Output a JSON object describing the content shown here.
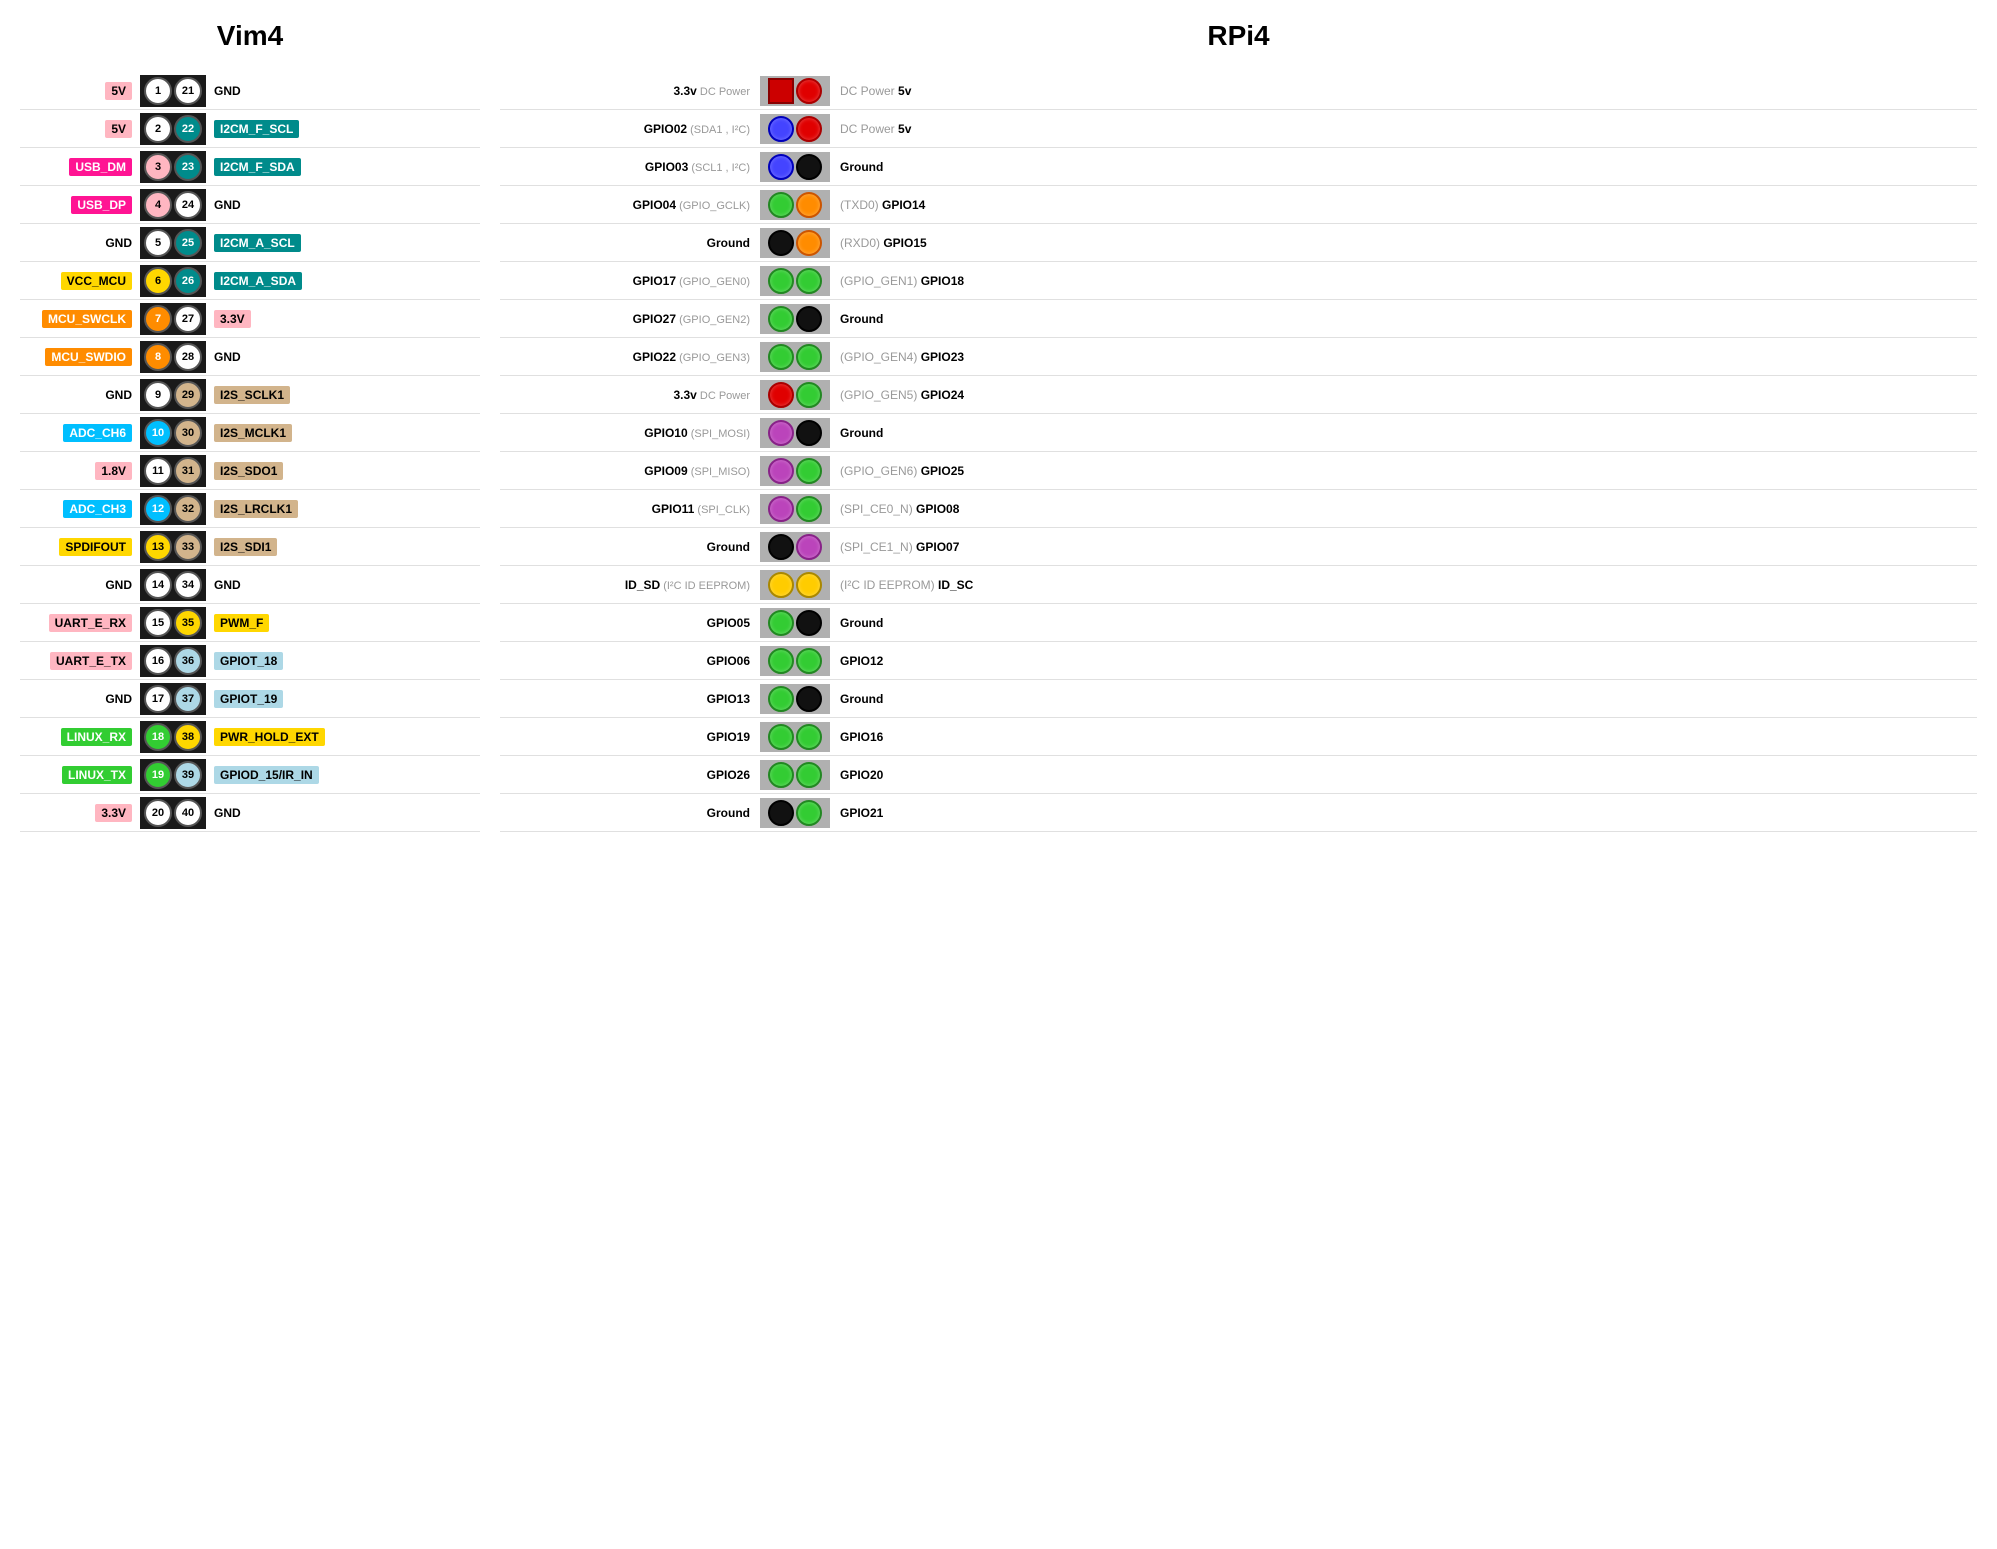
{
  "headers": {
    "vim4": "Vim4",
    "rpi4": "RPi4"
  },
  "vim4_rows": [
    {
      "left": "5V",
      "left_bg": "pink",
      "pin1": "1",
      "pin1_style": "white",
      "pin2": "21",
      "pin2_style": "white",
      "right": "GND",
      "right_bg": ""
    },
    {
      "left": "5V",
      "left_bg": "pink",
      "pin1": "2",
      "pin1_style": "white",
      "pin2": "22",
      "pin2_style": "teal",
      "right": "I2CM_F_SCL",
      "right_bg": "teal"
    },
    {
      "left": "USB_DM",
      "left_bg": "magenta",
      "pin1": "3",
      "pin1_style": "pink",
      "pin2": "23",
      "pin2_style": "teal",
      "right": "I2CM_F_SDA",
      "right_bg": "teal"
    },
    {
      "left": "USB_DP",
      "left_bg": "magenta",
      "pin1": "4",
      "pin1_style": "pink",
      "pin2": "24",
      "pin2_style": "white",
      "right": "GND",
      "right_bg": ""
    },
    {
      "left": "GND",
      "left_bg": "",
      "pin1": "5",
      "pin1_style": "white",
      "pin2": "25",
      "pin2_style": "teal",
      "right": "I2CM_A_SCL",
      "right_bg": "teal"
    },
    {
      "left": "VCC_MCU",
      "left_bg": "yellow",
      "pin1": "6",
      "pin1_style": "yellow",
      "pin2": "26",
      "pin2_style": "teal",
      "right": "I2CM_A_SDA",
      "right_bg": "teal"
    },
    {
      "left": "MCU_SWCLK",
      "left_bg": "orange",
      "pin1": "7",
      "pin1_style": "orange",
      "pin2": "27",
      "pin2_style": "white",
      "right": "3.3V",
      "right_bg": "pink"
    },
    {
      "left": "MCU_SWDIO",
      "left_bg": "orange",
      "pin1": "8",
      "pin1_style": "orange",
      "pin2": "28",
      "pin2_style": "white",
      "right": "GND",
      "right_bg": ""
    },
    {
      "left": "GND",
      "left_bg": "",
      "pin1": "9",
      "pin1_style": "white",
      "pin2": "29",
      "pin2_style": "tan",
      "right": "I2S_SCLK1",
      "right_bg": "tan"
    },
    {
      "left": "ADC_CH6",
      "left_bg": "blue",
      "pin1": "10",
      "pin1_style": "blue",
      "pin2": "30",
      "pin2_style": "tan",
      "right": "I2S_MCLK1",
      "right_bg": "tan"
    },
    {
      "left": "1.8V",
      "left_bg": "pink",
      "pin1": "11",
      "pin1_style": "white",
      "pin2": "31",
      "pin2_style": "tan",
      "right": "I2S_SDO1",
      "right_bg": "tan"
    },
    {
      "left": "ADC_CH3",
      "left_bg": "blue",
      "pin1": "12",
      "pin1_style": "blue",
      "pin2": "32",
      "pin2_style": "tan",
      "right": "I2S_LRCLK1",
      "right_bg": "tan"
    },
    {
      "left": "SPDIFOUT",
      "left_bg": "yellow",
      "pin1": "13",
      "pin1_style": "yellow",
      "pin2": "33",
      "pin2_style": "tan",
      "right": "I2S_SDI1",
      "right_bg": "tan"
    },
    {
      "left": "GND",
      "left_bg": "",
      "pin1": "14",
      "pin1_style": "white",
      "pin2": "34",
      "pin2_style": "white",
      "right": "GND",
      "right_bg": ""
    },
    {
      "left": "UART_E_RX",
      "left_bg": "pink",
      "pin1": "15",
      "pin1_style": "white",
      "pin2": "35",
      "pin2_style": "yellow",
      "right": "PWM_F",
      "right_bg": "yellow"
    },
    {
      "left": "UART_E_TX",
      "left_bg": "pink",
      "pin1": "16",
      "pin1_style": "white",
      "pin2": "36",
      "pin2_style": "lightblue",
      "right": "GPIOT_18",
      "right_bg": "lightblue"
    },
    {
      "left": "GND",
      "left_bg": "",
      "pin1": "17",
      "pin1_style": "white",
      "pin2": "37",
      "pin2_style": "lightblue",
      "right": "GPIOT_19",
      "right_bg": "lightblue"
    },
    {
      "left": "LINUX_RX",
      "left_bg": "green",
      "pin1": "18",
      "pin1_style": "green",
      "pin2": "38",
      "pin2_style": "yellow",
      "right": "PWR_HOLD_EXT",
      "right_bg": "yellow"
    },
    {
      "left": "LINUX_TX",
      "left_bg": "green",
      "pin1": "19",
      "pin1_style": "green",
      "pin2": "39",
      "pin2_style": "lightblue",
      "right": "GPIOD_15/IR_IN",
      "right_bg": "lightblue"
    },
    {
      "left": "3.3V",
      "left_bg": "pink",
      "pin1": "20",
      "pin1_style": "white",
      "pin2": "40",
      "pin2_style": "white",
      "right": "GND",
      "right_bg": ""
    }
  ],
  "rpi4_rows": [
    {
      "left_main": "3.3v",
      "left_sub": " DC Power",
      "pin_left": "redsquare",
      "pin_right": "red",
      "right_sub": "DC Power ",
      "right_main": "5v"
    },
    {
      "left_main": "GPIO02",
      "left_sub": " (SDA1 , I²C)",
      "pin_left": "blue",
      "pin_right": "red",
      "right_sub": "DC Power ",
      "right_main": "5v"
    },
    {
      "left_main": "GPIO03",
      "left_sub": " (SCL1 , I²C)",
      "pin_left": "blue",
      "pin_right": "black",
      "right_sub": "",
      "right_main": "Ground"
    },
    {
      "left_main": "GPIO04",
      "left_sub": " (GPIO_GCLK)",
      "pin_left": "green",
      "pin_right": "orange",
      "right_sub": "(TXD0) ",
      "right_main": "GPIO14"
    },
    {
      "left_main": "Ground",
      "left_sub": "",
      "pin_left": "black",
      "pin_right": "orange",
      "right_sub": "(RXD0) ",
      "right_main": "GPIO15"
    },
    {
      "left_main": "GPIO17",
      "left_sub": " (GPIO_GEN0)",
      "pin_left": "green",
      "pin_right": "green",
      "right_sub": "(GPIO_GEN1) ",
      "right_main": "GPIO18"
    },
    {
      "left_main": "GPIO27",
      "left_sub": " (GPIO_GEN2)",
      "pin_left": "green",
      "pin_right": "black",
      "right_sub": "",
      "right_main": "Ground"
    },
    {
      "left_main": "GPIO22",
      "left_sub": " (GPIO_GEN3)",
      "pin_left": "green",
      "pin_right": "green",
      "right_sub": "(GPIO_GEN4) ",
      "right_main": "GPIO23"
    },
    {
      "left_main": "3.3v",
      "left_sub": " DC Power",
      "pin_left": "red",
      "pin_right": "green",
      "right_sub": "(GPIO_GEN5) ",
      "right_main": "GPIO24"
    },
    {
      "left_main": "GPIO10",
      "left_sub": " (SPI_MOSI)",
      "pin_left": "purple",
      "pin_right": "black",
      "right_sub": "",
      "right_main": "Ground"
    },
    {
      "left_main": "GPIO09",
      "left_sub": " (SPI_MISO)",
      "pin_left": "purple",
      "pin_right": "green",
      "right_sub": "(GPIO_GEN6) ",
      "right_main": "GPIO25"
    },
    {
      "left_main": "GPIO11",
      "left_sub": " (SPI_CLK)",
      "pin_left": "purple",
      "pin_right": "green",
      "right_sub": "(SPI_CE0_N) ",
      "right_main": "GPIO08"
    },
    {
      "left_main": "Ground",
      "left_sub": "",
      "pin_left": "black",
      "pin_right": "purple",
      "right_sub": "(SPI_CE1_N) ",
      "right_main": "GPIO07"
    },
    {
      "left_main": "ID_SD",
      "left_sub": " (I²C ID EEPROM)",
      "pin_left": "yellow",
      "pin_right": "yellow",
      "right_sub": "(I²C ID EEPROM) ",
      "right_main": "ID_SC"
    },
    {
      "left_main": "GPIO05",
      "left_sub": "",
      "pin_left": "green",
      "pin_right": "black",
      "right_sub": "",
      "right_main": "Ground"
    },
    {
      "left_main": "GPIO06",
      "left_sub": "",
      "pin_left": "green",
      "pin_right": "green",
      "right_sub": "",
      "right_main": "GPIO12"
    },
    {
      "left_main": "GPIO13",
      "left_sub": "",
      "pin_left": "green",
      "pin_right": "black",
      "right_sub": "",
      "right_main": "Ground"
    },
    {
      "left_main": "GPIO19",
      "left_sub": "",
      "pin_left": "green",
      "pin_right": "green",
      "right_sub": "",
      "right_main": "GPIO16"
    },
    {
      "left_main": "GPIO26",
      "left_sub": "",
      "pin_left": "green",
      "pin_right": "green",
      "right_sub": "",
      "right_main": "GPIO20"
    },
    {
      "left_main": "Ground",
      "left_sub": "",
      "pin_left": "black",
      "pin_right": "green",
      "right_sub": "",
      "right_main": "GPIO21"
    }
  ]
}
